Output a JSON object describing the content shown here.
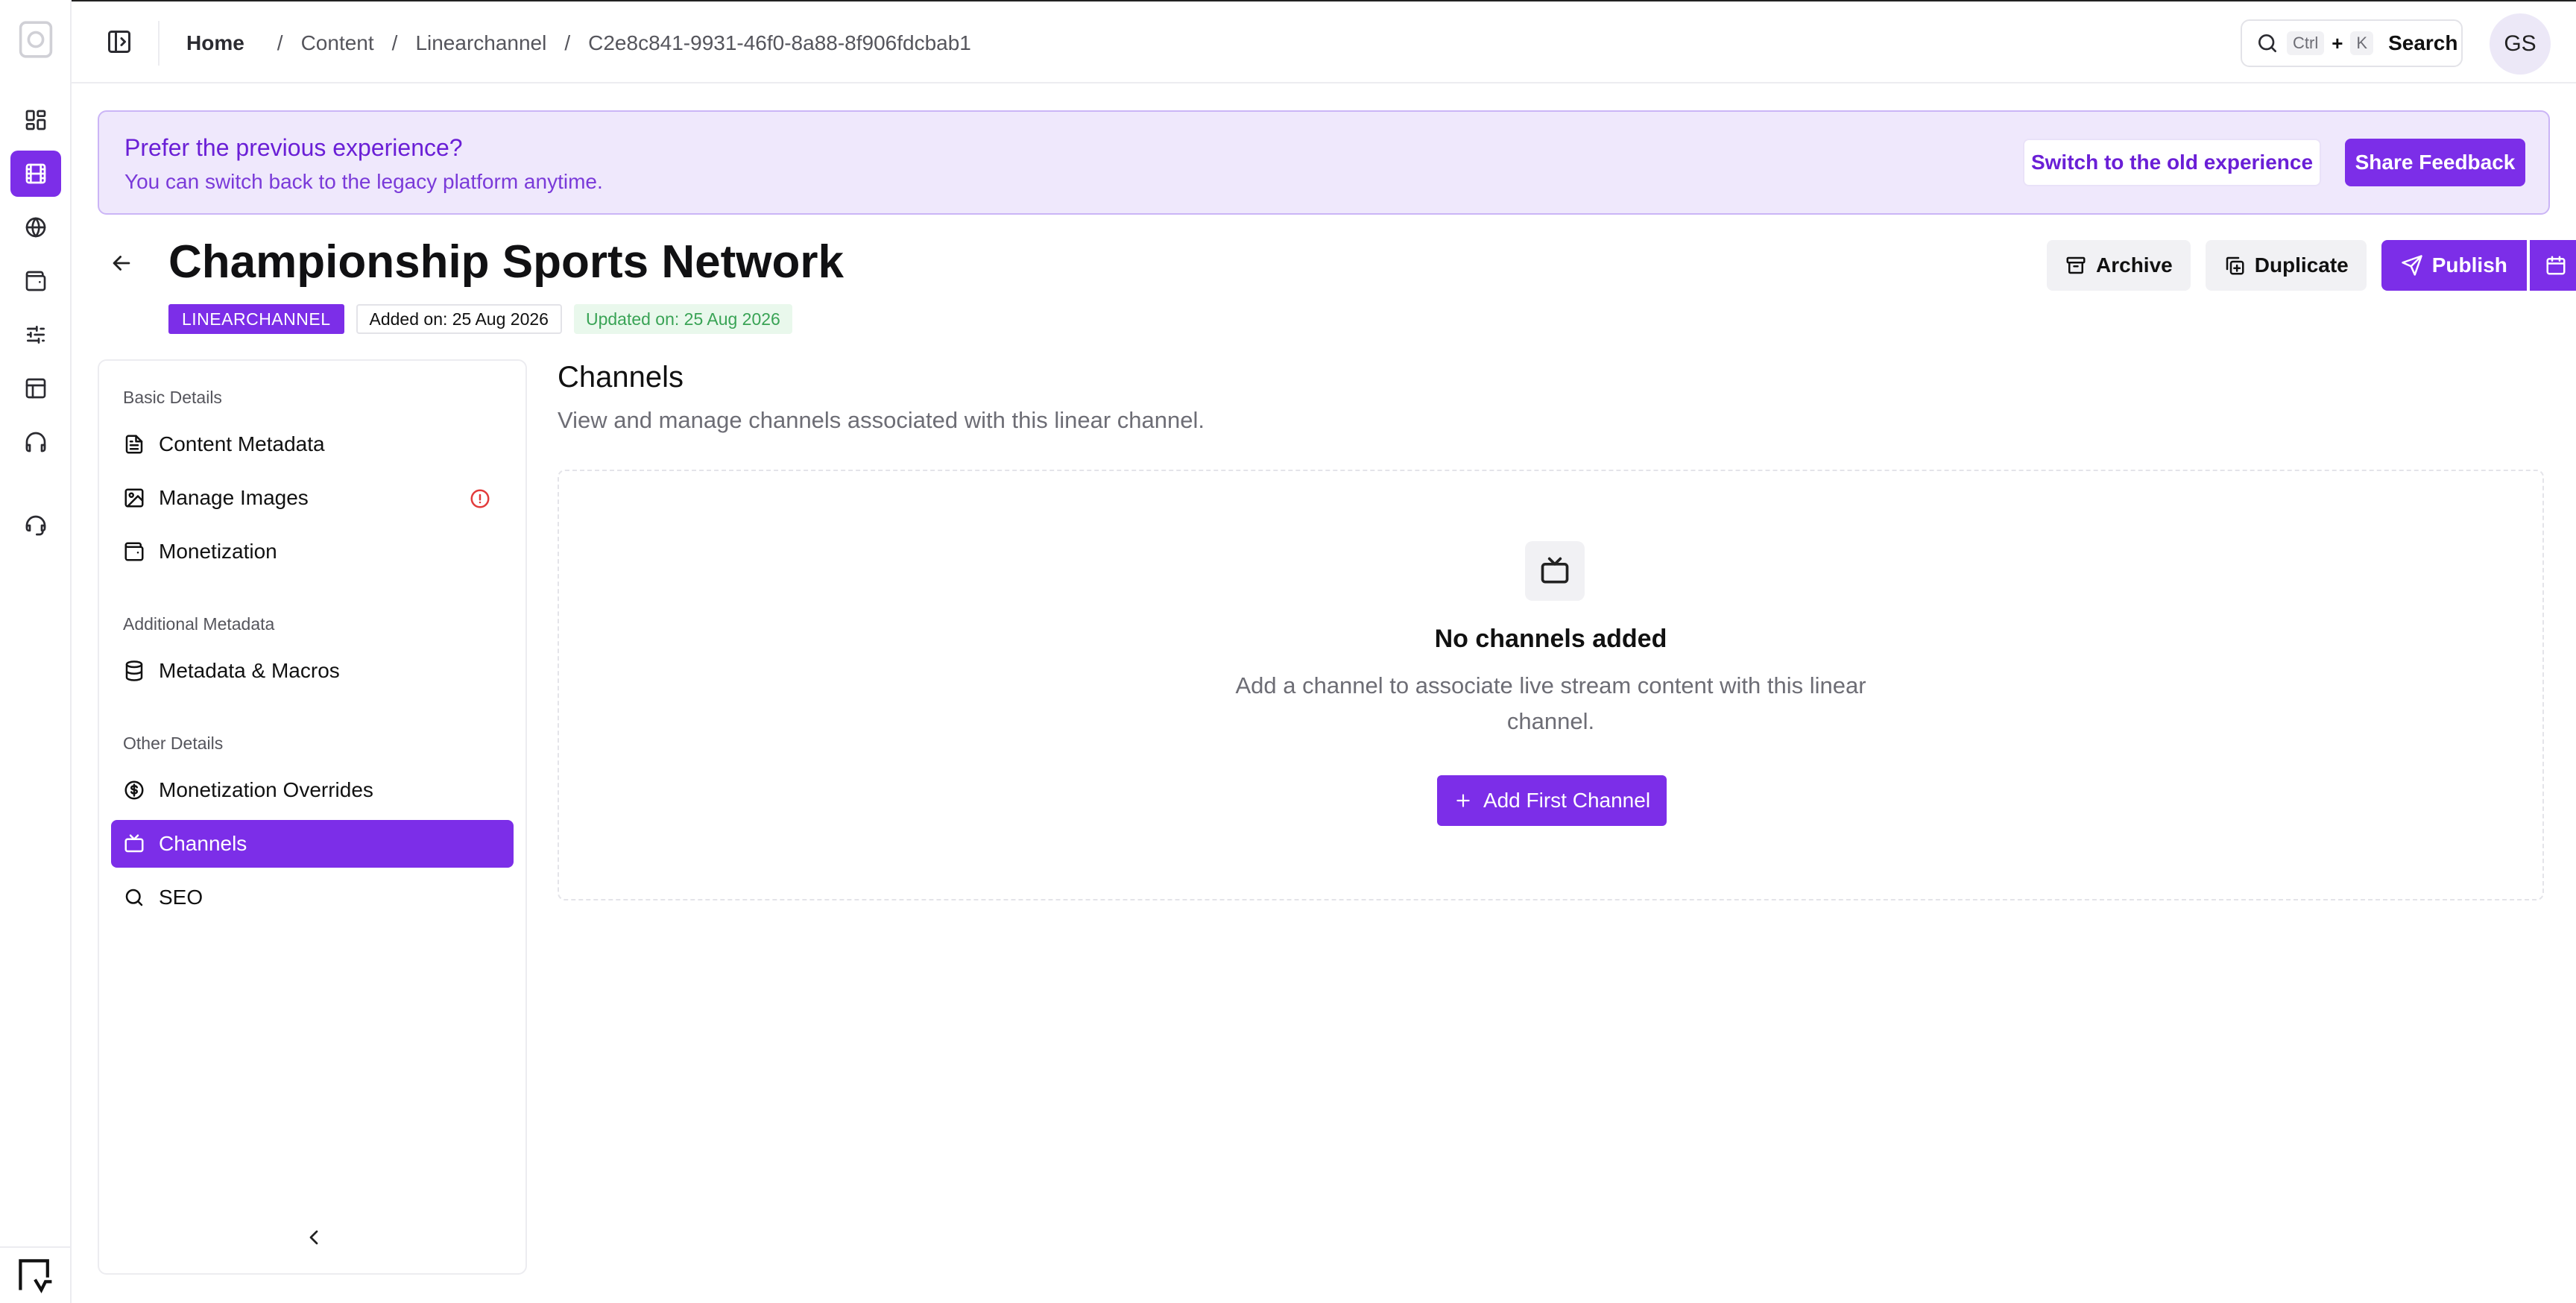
{
  "breadcrumb": {
    "home": "Home",
    "items": [
      "Content",
      "Linearchannel",
      "C2e8c841-9931-46f0-8a88-8f906fdcbab1"
    ]
  },
  "search": {
    "kbd_ctrl": "Ctrl",
    "kbd_plus": "+",
    "kbd_k": "K",
    "label": "Search"
  },
  "user": {
    "initials": "GS"
  },
  "banner": {
    "title": "Prefer the previous experience?",
    "subtitle": "You can switch back to the legacy platform anytime.",
    "switch_label": "Switch to the old experience",
    "feedback_label": "Share Feedback"
  },
  "page": {
    "title": "Championship Sports Network",
    "type_badge": "LINEARCHANNEL",
    "added": "Added on: 25 Aug 2026",
    "updated": "Updated on: 25 Aug 2026"
  },
  "actions": {
    "archive": "Archive",
    "duplicate": "Duplicate",
    "publish": "Publish"
  },
  "nav": {
    "groups": [
      {
        "label": "Basic Details",
        "items": [
          "Content Metadata",
          "Manage Images",
          "Monetization"
        ]
      },
      {
        "label": "Additional Metadata",
        "items": [
          "Metadata & Macros"
        ]
      },
      {
        "label": "Other Details",
        "items": [
          "Monetization Overrides",
          "Channels",
          "SEO"
        ]
      }
    ],
    "active": "Channels"
  },
  "content": {
    "title": "Channels",
    "description": "View and manage channels associated with this linear channel.",
    "empty_title": "No channels added",
    "empty_description": "Add a channel to associate live stream content with this linear channel.",
    "add_button": "Add First Channel"
  },
  "colors": {
    "accent": "#7c2ee8",
    "banner_bg": "#efe8fc",
    "updated_green": "#39a355",
    "warning": "#e23b3b"
  },
  "icons": {
    "rail": [
      "dashboard-icon",
      "film-icon",
      "globe-icon",
      "wallet-icon",
      "sliders-icon",
      "layout-icon",
      "headphones-icon",
      "support-icon"
    ]
  }
}
